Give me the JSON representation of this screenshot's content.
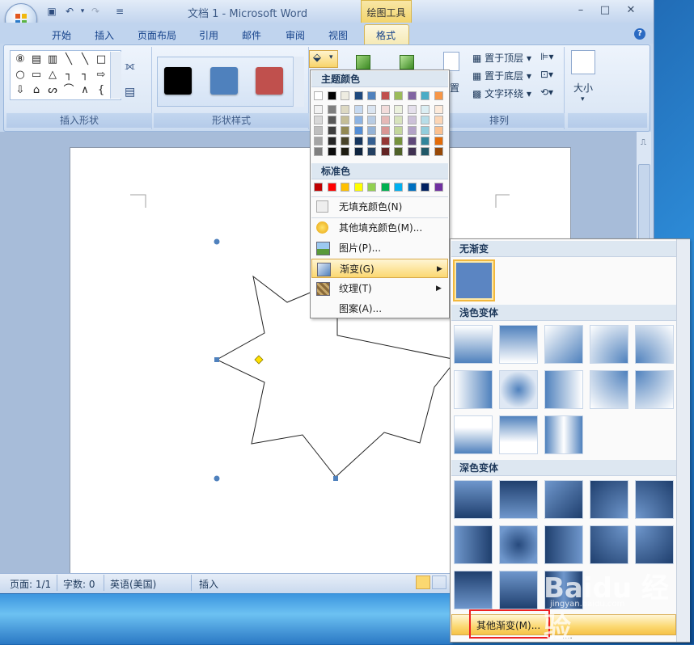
{
  "window": {
    "title": "文档 1 - Microsoft Word",
    "context_tab_group": "绘图工具",
    "controls": {
      "minimize": "–",
      "maximize": "□",
      "close": "✕"
    },
    "help": "?"
  },
  "quick_access": {
    "save_icon": "save-icon",
    "undo_icon": "undo-icon",
    "redo_icon": "redo-icon",
    "customize_icon": "customize-icon"
  },
  "tabs": [
    "开始",
    "插入",
    "页面布局",
    "引用",
    "邮件",
    "审阅",
    "视图",
    "格式"
  ],
  "active_tab": "格式",
  "ribbon": {
    "insert_shapes": {
      "label": "插入形状",
      "glyphs": [
        "⑧",
        "▤",
        "▥",
        "╲",
        "╲",
        "□",
        "○",
        "▭",
        "△",
        "┐",
        "┐",
        "⇨",
        "⇩",
        "⌂",
        "ᔕ",
        "⌒",
        "∧",
        "{"
      ]
    },
    "shape_styles": {
      "label": "形状样式",
      "swatches": [
        "#000000",
        "#4f81bd",
        "#c0504d"
      ]
    },
    "arrange": {
      "label": "排列",
      "bring_front": "置于顶层",
      "send_back": "置于底层",
      "text_wrap": "文字环绕",
      "position_partial": "置"
    },
    "size": {
      "label": "大小"
    }
  },
  "fill_menu": {
    "theme_colors_title": "主题颜色",
    "theme_top_row": [
      "#ffffff",
      "#000000",
      "#eeece1",
      "#1f497d",
      "#4f81bd",
      "#c0504d",
      "#9bbb59",
      "#8064a2",
      "#4bacc6",
      "#f79646"
    ],
    "theme_shades": [
      [
        "#f2f2f2",
        "#7f7f7f",
        "#ddd9c3",
        "#c6d9f0",
        "#dbe5f1",
        "#f2dcdb",
        "#ebf1dd",
        "#e5e0ec",
        "#dbeef3",
        "#fdeada"
      ],
      [
        "#d8d8d8",
        "#595959",
        "#c4bd97",
        "#8db3e2",
        "#b8cce4",
        "#e5b9b7",
        "#d7e3bc",
        "#ccc1d9",
        "#b7dde8",
        "#fbd5b5"
      ],
      [
        "#bfbfbf",
        "#3f3f3f",
        "#938953",
        "#548dd4",
        "#95b3d7",
        "#d99694",
        "#c3d69b",
        "#b2a2c7",
        "#92cddc",
        "#fac08f"
      ],
      [
        "#a5a5a5",
        "#262626",
        "#494429",
        "#17365d",
        "#366092",
        "#953734",
        "#76923c",
        "#5f497a",
        "#31859b",
        "#e36c09"
      ],
      [
        "#7f7f7f",
        "#0c0c0c",
        "#1d1b10",
        "#0f243e",
        "#244061",
        "#632423",
        "#4f6128",
        "#3f3151",
        "#205867",
        "#974806"
      ]
    ],
    "standard_colors_title": "标准色",
    "standard_colors": [
      "#c00000",
      "#ff0000",
      "#ffc000",
      "#ffff00",
      "#92d050",
      "#00b050",
      "#00b0f0",
      "#0070c0",
      "#002060",
      "#7030a0"
    ],
    "items": [
      {
        "label": "无填充颜色(N)",
        "icon": "no-fill-icon"
      },
      {
        "label": "其他填充颜色(M)...",
        "icon": "palette-icon"
      },
      {
        "label": "图片(P)...",
        "icon": "picture-icon"
      },
      {
        "label": "渐变(G)",
        "icon": "gradient-icon",
        "has_submenu": true,
        "highlighted": true
      },
      {
        "label": "纹理(T)",
        "icon": "texture-icon",
        "has_submenu": true
      },
      {
        "label": "图案(A)...",
        "icon": ""
      }
    ]
  },
  "gradient_submenu": {
    "no_gradient_title": "无渐变",
    "light_variations_title": "浅色变体",
    "dark_variations_title": "深色变体",
    "more_gradients": "其他渐变(M)...",
    "base_color": "#4f81bd"
  },
  "status_bar": {
    "page": "页面: 1/1",
    "words": "字数: 0",
    "language": "英语(美国)",
    "mode": "插入"
  },
  "watermark": {
    "text": "Baidu 经验",
    "url": "jingyan.baidu.com"
  }
}
